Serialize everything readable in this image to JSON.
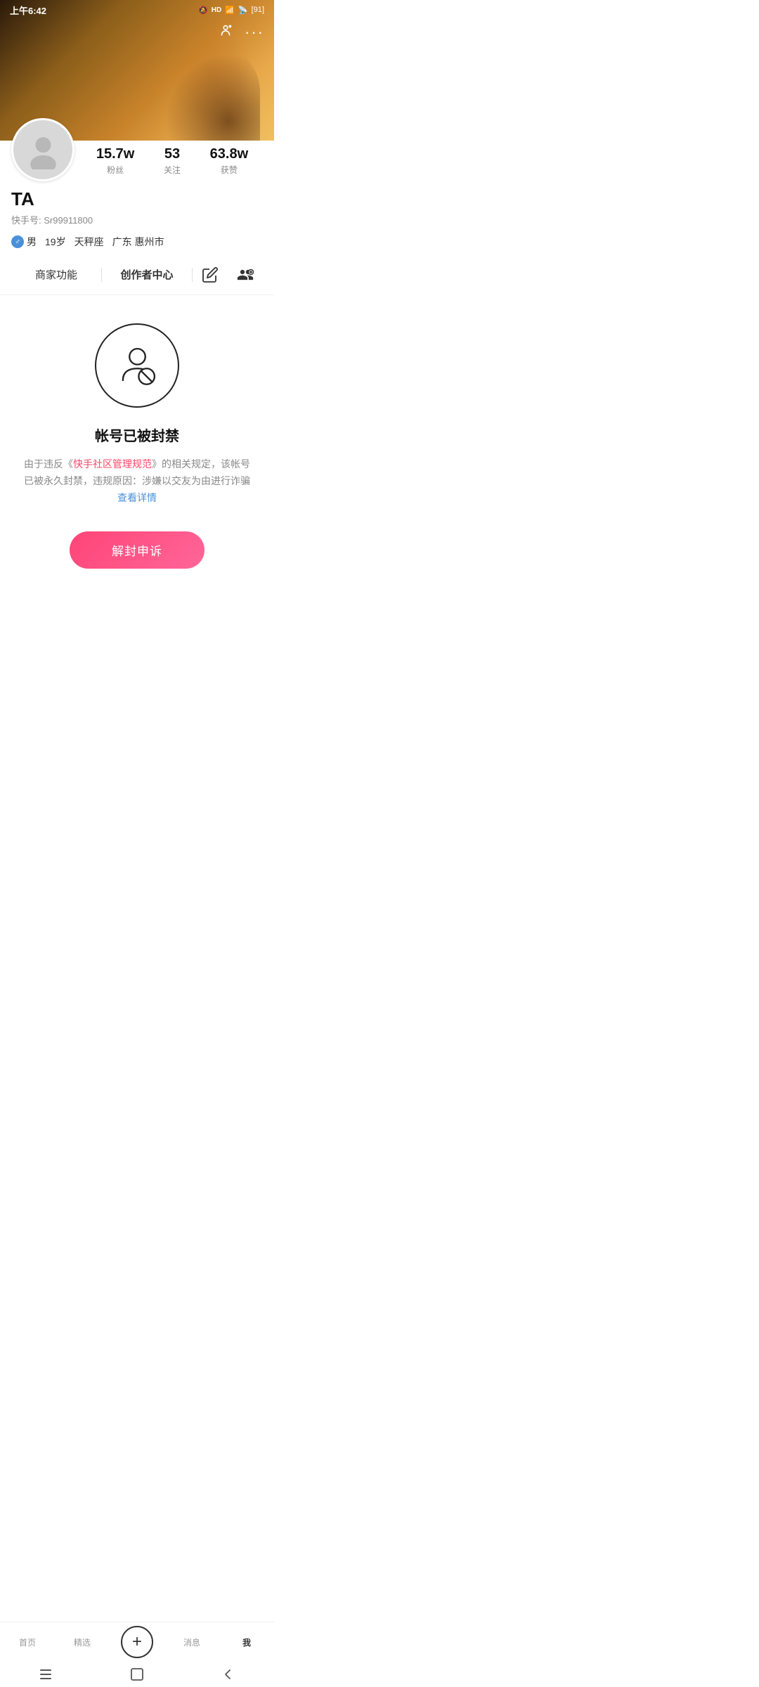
{
  "statusBar": {
    "time": "上午6:42",
    "hdLabel": "HD",
    "battery": "91"
  },
  "cover": {
    "topIcons": {
      "qrIcon": "QR",
      "moreIcon": "···"
    }
  },
  "profile": {
    "username": "TA",
    "userId": "快手号: Sr99911800",
    "stats": {
      "fans": {
        "value": "15.7w",
        "label": "粉丝"
      },
      "following": {
        "value": "53",
        "label": "关注"
      },
      "likes": {
        "value": "63.8w",
        "label": "获赞"
      }
    },
    "tags": {
      "gender": "男",
      "age": "19岁",
      "zodiac": "天秤座",
      "location": "广东 惠州市"
    }
  },
  "actionBar": {
    "merchant": "商家功能",
    "creator": "创作者中心",
    "editTooltip": "编辑",
    "addFriendTooltip": "加好友"
  },
  "banned": {
    "title": "帐号已被封禁",
    "descPart1": "由于违反《",
    "descHighlight": "快手社区管理规范",
    "descPart2": "》的相关规定，该帐号已被永久封禁，违规原因：涉嫌以交友为由进行诈骗",
    "descLink": "查看详情",
    "appealBtn": "解封申诉"
  },
  "bottomNav": {
    "items": [
      {
        "label": "首页",
        "active": false
      },
      {
        "label": "精选",
        "active": false
      },
      {
        "label": "+",
        "active": false,
        "isPlus": true
      },
      {
        "label": "消息",
        "active": false
      },
      {
        "label": "我",
        "active": true
      }
    ]
  }
}
